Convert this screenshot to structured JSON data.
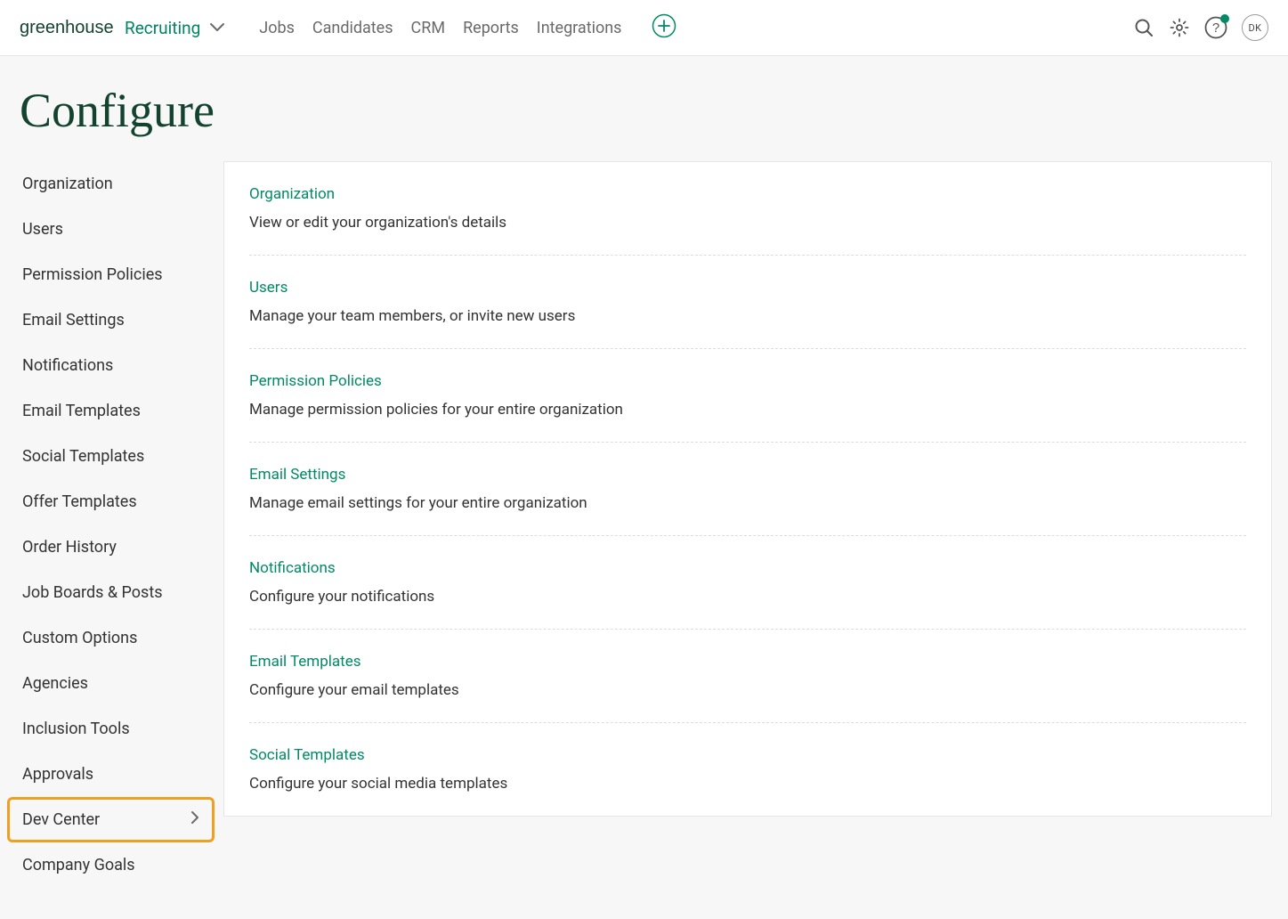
{
  "brand": {
    "main": "greenhouse",
    "sub": "Recruiting"
  },
  "nav": {
    "jobs": "Jobs",
    "candidates": "Candidates",
    "crm": "CRM",
    "reports": "Reports",
    "integrations": "Integrations"
  },
  "avatar_initials": "DK",
  "page_title": "Configure",
  "sidebar": {
    "items": [
      {
        "label": "Organization",
        "highlighted": false,
        "chevron": false
      },
      {
        "label": "Users",
        "highlighted": false,
        "chevron": false
      },
      {
        "label": "Permission Policies",
        "highlighted": false,
        "chevron": false
      },
      {
        "label": "Email Settings",
        "highlighted": false,
        "chevron": false
      },
      {
        "label": "Notifications",
        "highlighted": false,
        "chevron": false
      },
      {
        "label": "Email Templates",
        "highlighted": false,
        "chevron": false
      },
      {
        "label": "Social Templates",
        "highlighted": false,
        "chevron": false
      },
      {
        "label": "Offer Templates",
        "highlighted": false,
        "chevron": false
      },
      {
        "label": "Order History",
        "highlighted": false,
        "chevron": false
      },
      {
        "label": "Job Boards & Posts",
        "highlighted": false,
        "chevron": false
      },
      {
        "label": "Custom Options",
        "highlighted": false,
        "chevron": false
      },
      {
        "label": "Agencies",
        "highlighted": false,
        "chevron": false
      },
      {
        "label": "Inclusion Tools",
        "highlighted": false,
        "chevron": false
      },
      {
        "label": "Approvals",
        "highlighted": false,
        "chevron": false
      },
      {
        "label": "Dev Center",
        "highlighted": true,
        "chevron": true
      },
      {
        "label": "Company Goals",
        "highlighted": false,
        "chevron": false
      }
    ]
  },
  "sections": [
    {
      "title": "Organization",
      "desc": "View or edit your organization's details"
    },
    {
      "title": "Users",
      "desc": "Manage your team members, or invite new users"
    },
    {
      "title": "Permission Policies",
      "desc": "Manage permission policies for your entire organization"
    },
    {
      "title": "Email Settings",
      "desc": "Manage email settings for your entire organization"
    },
    {
      "title": "Notifications",
      "desc": "Configure your notifications"
    },
    {
      "title": "Email Templates",
      "desc": "Configure your email templates"
    },
    {
      "title": "Social Templates",
      "desc": "Configure your social media templates"
    }
  ]
}
